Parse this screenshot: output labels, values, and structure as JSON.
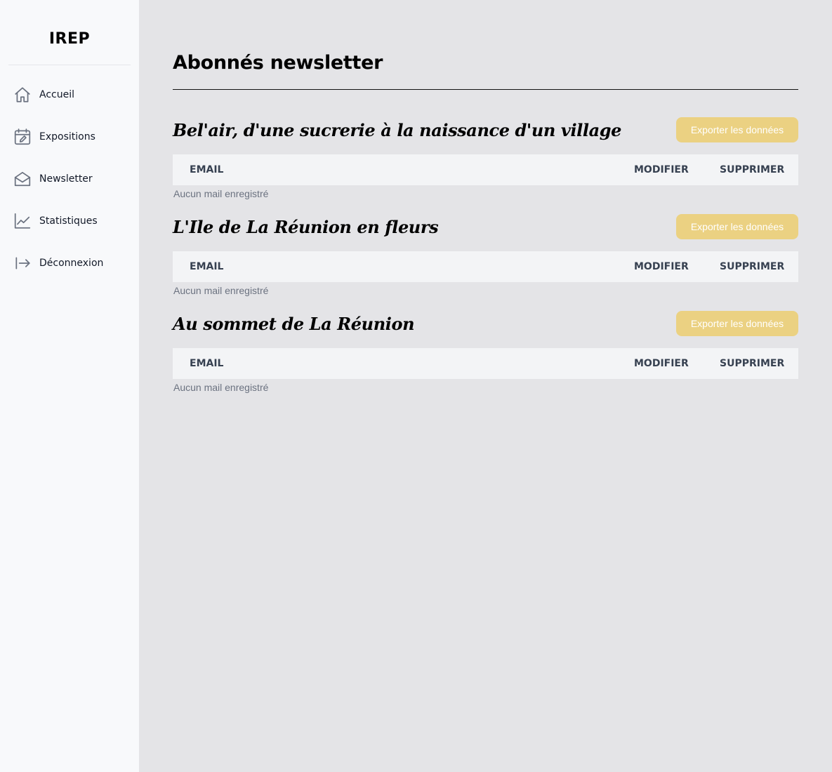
{
  "sidebar": {
    "logo": "IREP",
    "items": [
      {
        "label": "Accueil",
        "icon": "home-icon"
      },
      {
        "label": "Expositions",
        "icon": "calendar-edit-icon"
      },
      {
        "label": "Newsletter",
        "icon": "envelope-open-icon"
      },
      {
        "label": "Statistiques",
        "icon": "chart-line-icon"
      },
      {
        "label": "Déconnexion",
        "icon": "logout-arrow-icon"
      }
    ]
  },
  "main": {
    "title": "Abonnés newsletter",
    "export_label": "Exporter les données",
    "table_headers": {
      "email": "EMAIL",
      "modifier": "MODIFIER",
      "supprimer": "SUPPRIMER"
    },
    "empty_message": "Aucun mail enregistré",
    "sections": [
      {
        "title": "Bel'air, d'une sucrerie à la naissance d'un village"
      },
      {
        "title": "L'Ile de La Réunion en fleurs"
      },
      {
        "title": "Au sommet de La Réunion"
      }
    ]
  },
  "colors": {
    "accent_button": "#ebd182",
    "sidebar_bg": "#f8f9fb",
    "main_bg": "#e4e4e7",
    "table_header_bg": "#f3f4f6"
  }
}
